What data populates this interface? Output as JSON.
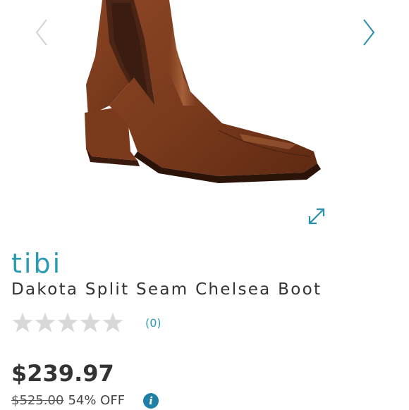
{
  "product": {
    "brand": "tibi",
    "title": "Dakota Split Seam Chelsea Boot",
    "image_subject": "brown leather chelsea boot",
    "rating": {
      "stars_filled": 0,
      "stars_total": 5,
      "review_count": "(0)"
    },
    "price": "$239.97",
    "original_price": "$525.00",
    "discount": "54% OFF"
  },
  "icons": {
    "prev": "chevron-left-icon",
    "next": "chevron-right-icon",
    "expand": "expand-icon",
    "info": "info-icon",
    "info_glyph": "i"
  },
  "colors": {
    "brand": "#2a9bb4",
    "text": "#333333",
    "star_empty": "#d8d8d8",
    "boot": "#7a3b1f",
    "info": "#1f7fa6"
  }
}
